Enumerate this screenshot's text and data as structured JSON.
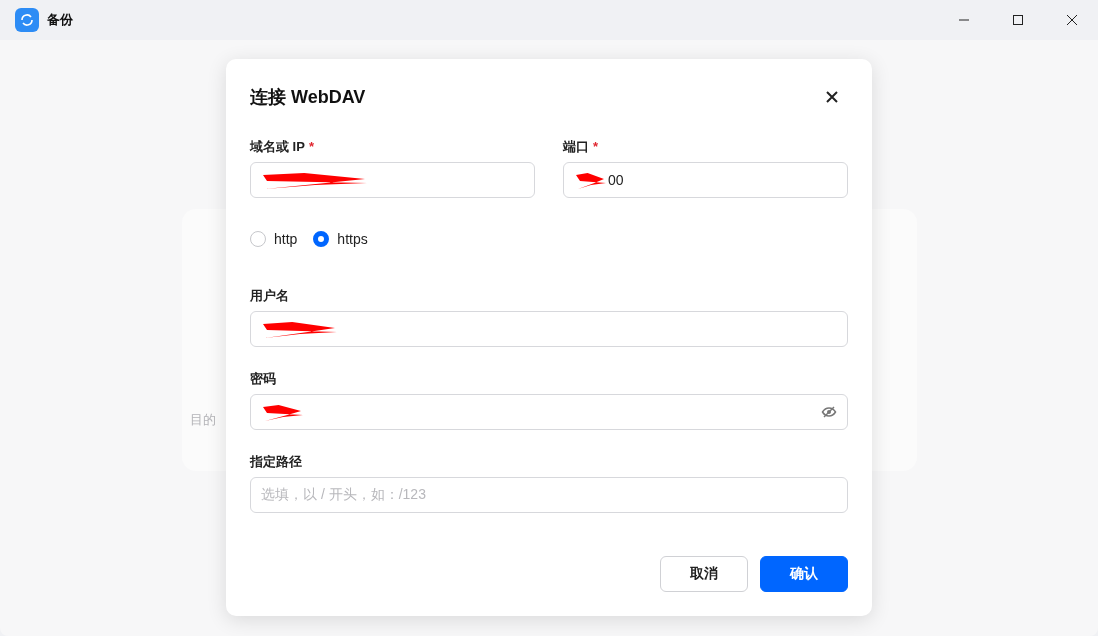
{
  "window": {
    "title": "备份"
  },
  "background": {
    "label": "目的"
  },
  "dialog": {
    "title": "连接 WebDAV",
    "fields": [
      {
        "kind": "text",
        "label": "域名或 IP",
        "required_mark": "*",
        "redacted": true,
        "half": true
      },
      {
        "kind": "text",
        "label": "端口",
        "required_mark": "*",
        "redacted": true,
        "value": "00",
        "half": true
      },
      {
        "kind": "radio",
        "options": [
          {
            "label": "http",
            "selected": false
          },
          {
            "label": "https",
            "selected": true
          }
        ]
      },
      {
        "kind": "text",
        "label": "用户名",
        "redacted": true
      },
      {
        "kind": "password",
        "label": "密码",
        "redacted": true
      },
      {
        "kind": "text",
        "label": "指定路径",
        "redacted": false,
        "placeholder": "选填，以 / 开头，如：/123"
      }
    ],
    "buttons": [
      {
        "label": "取消",
        "primary": false
      },
      {
        "label": "确认",
        "primary": true
      }
    ]
  }
}
